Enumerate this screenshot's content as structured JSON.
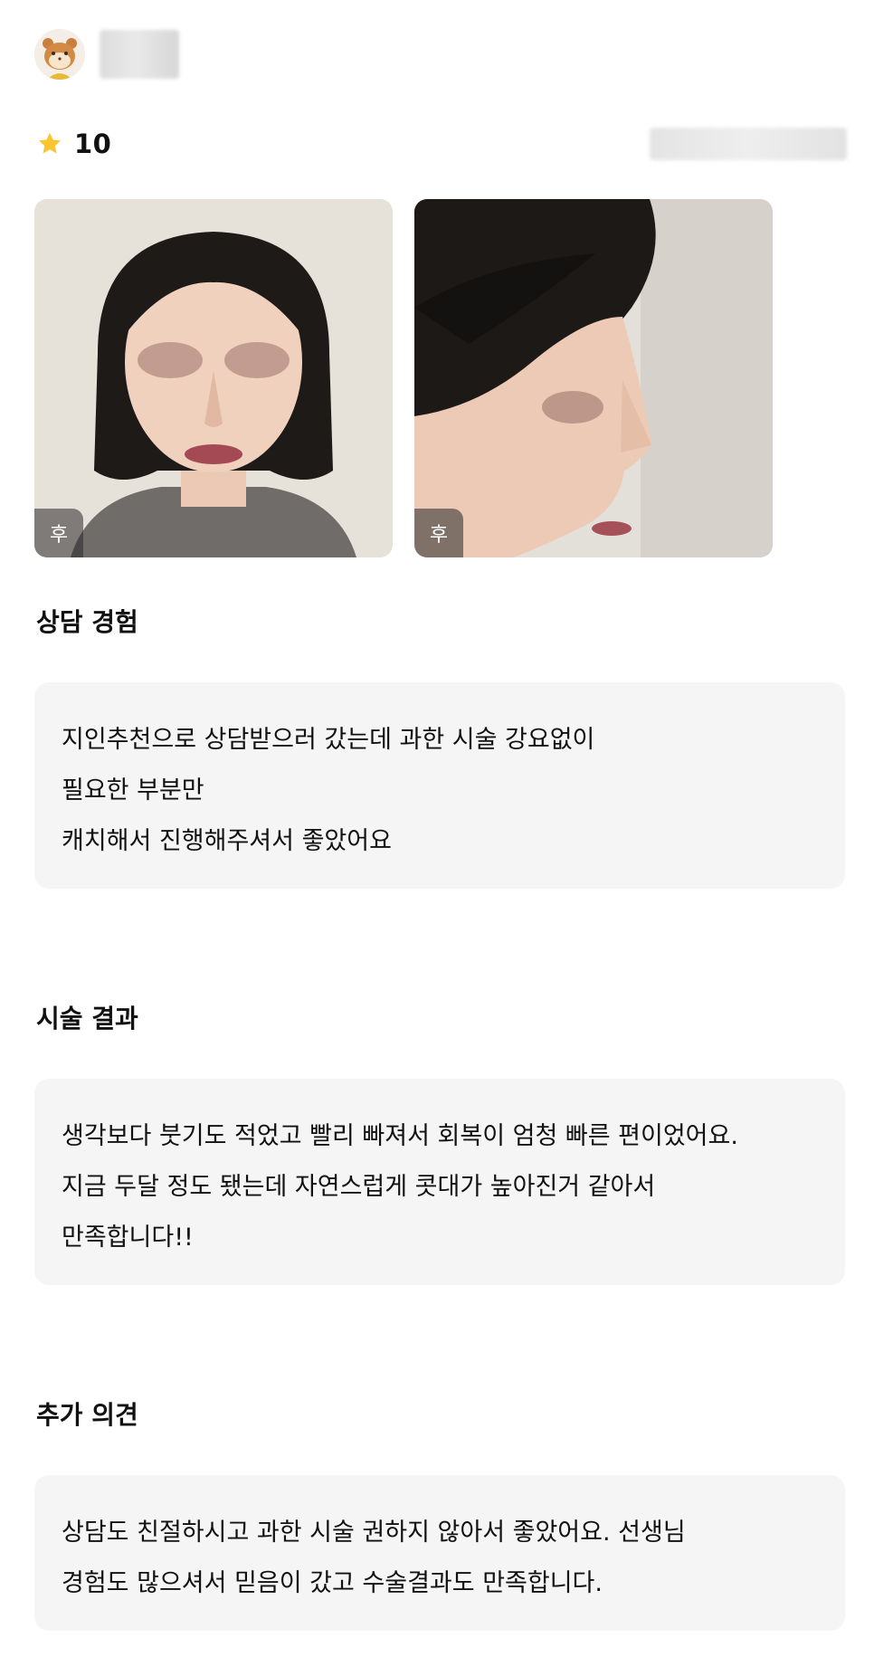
{
  "review": {
    "avatar_icon": "hamster-avatar-icon",
    "rating": {
      "icon": "star-icon",
      "value": "10",
      "star_color": "#FBC530"
    },
    "photos": [
      {
        "badge": "후",
        "view": "front"
      },
      {
        "badge": "후",
        "view": "profile"
      }
    ],
    "sections": [
      {
        "title": "상담 경험",
        "lines": [
          "지인추천으로 상담받으러 갔는데 과한 시술 강요없이",
          "필요한 부분만",
          "캐치해서 진행해주셔서 좋았어요"
        ]
      },
      {
        "title": "시술 결과",
        "lines": [
          "생각보다 붓기도 적었고 빨리 빠져서 회복이 엄청 빠른 편이었어요.",
          "지금 두달 정도 됐는데 자연스럽게 콧대가 높아진거 같아서",
          "만족합니다!!"
        ]
      },
      {
        "title": "추가 의견",
        "lines": [
          "상담도 친절하시고 과한 시술 권하지 않아서 좋았어요. 선생님",
          "경험도 많으셔서 믿음이 갔고 수술결과도 만족합니다."
        ]
      }
    ]
  }
}
